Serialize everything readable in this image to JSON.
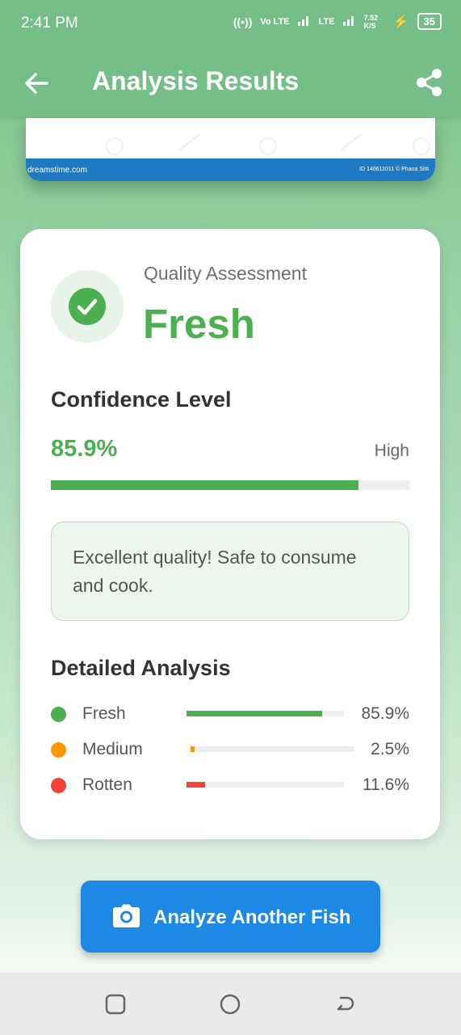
{
  "status_bar": {
    "time": "2:41 PM",
    "signal_text_1": "Vo LTE",
    "signal_text_2": "LTE",
    "speed": "7.52 K/S",
    "battery": "35"
  },
  "app_bar": {
    "title": "Analysis Results",
    "back_icon": "arrow-left-icon",
    "share_icon": "share-icon"
  },
  "image_preview": {
    "watermark_brand": "dreamstime.com",
    "watermark_id": "ID 146611011 © Phana Sitti"
  },
  "assessment": {
    "label": "Quality Assessment",
    "value": "Fresh",
    "icon": "check-circle-icon",
    "color": "#4caf50"
  },
  "confidence": {
    "title": "Confidence Level",
    "value_text": "85.9%",
    "level_text": "High",
    "fill_fraction": 0.859
  },
  "message": {
    "text": "Excellent quality! Safe to consume and cook."
  },
  "detailed_analysis": {
    "title": "Detailed Analysis",
    "rows": [
      {
        "label": "Fresh",
        "percent_text": "85.9%",
        "fraction": 0.859,
        "color": "#4caf50"
      },
      {
        "label": "Medium",
        "percent_text": "2.5%",
        "fraction": 0.025,
        "color": "#ff9800"
      },
      {
        "label": "Rotten",
        "percent_text": "11.6%",
        "fraction": 0.116,
        "color": "#f44336"
      }
    ]
  },
  "primary_button": {
    "label": "Analyze Another Fish",
    "icon": "camera-icon",
    "color": "#1e88e5"
  },
  "nav_bar": {
    "recent_icon": "recent-apps-icon",
    "home_icon": "home-icon",
    "back_icon": "system-back-icon"
  }
}
